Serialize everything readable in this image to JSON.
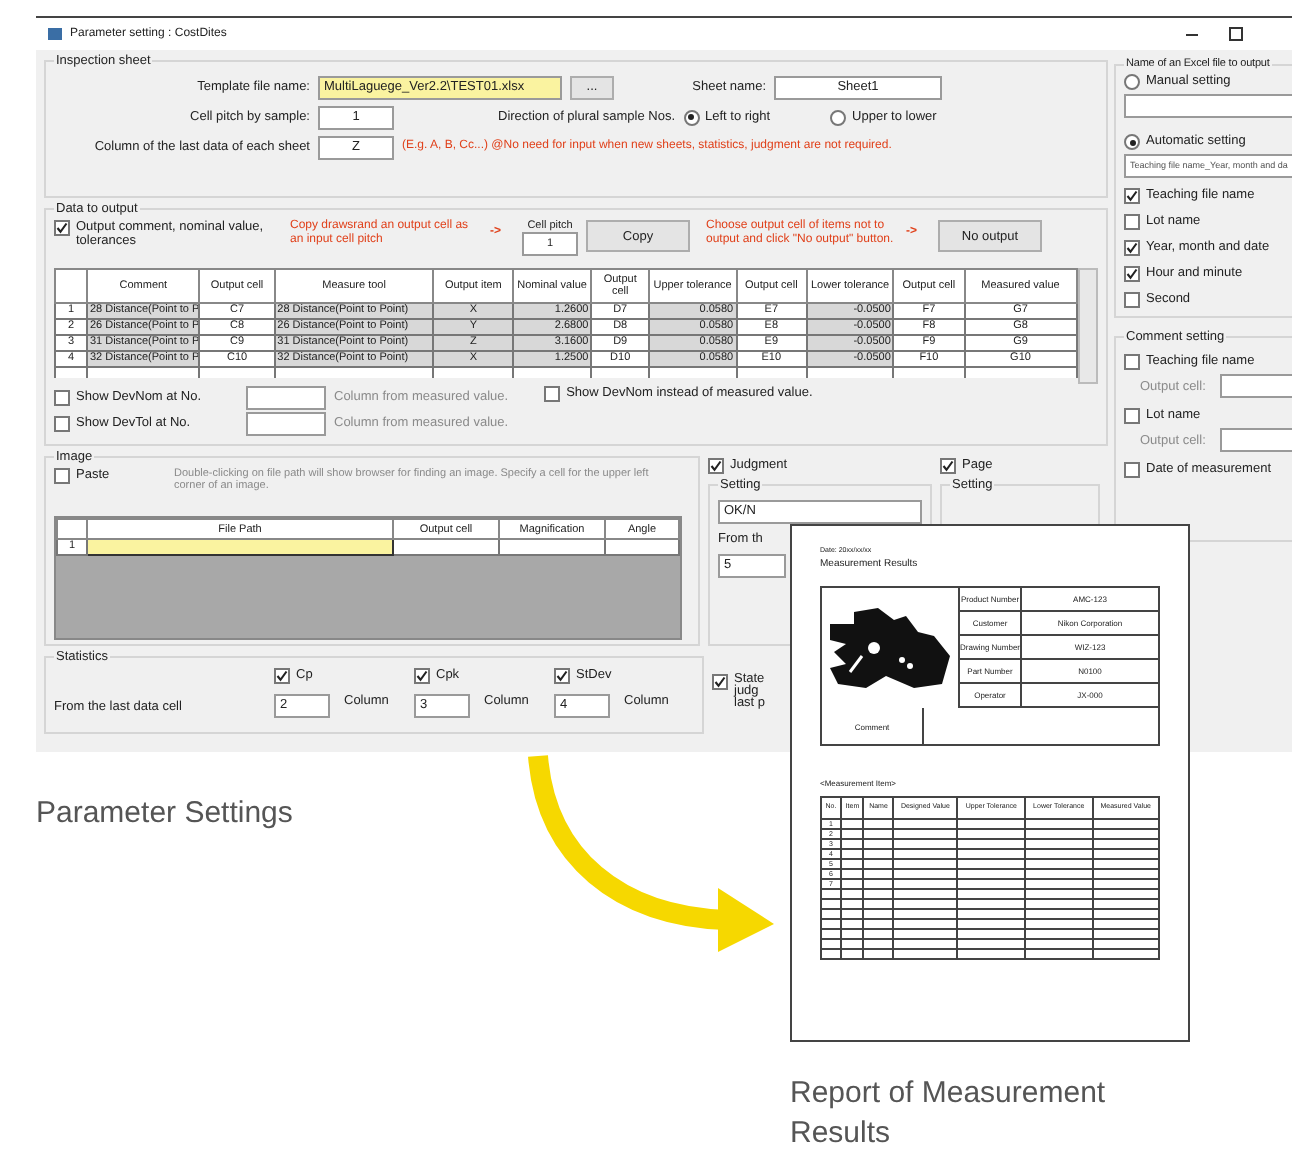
{
  "window": {
    "title": "Parameter setting : CostDites"
  },
  "inspection_sheet": {
    "title": "Inspection sheet",
    "template_label": "Template file name:",
    "template_value": "MultiLaguege_Ver2.2\\TEST01.xlsx",
    "browse_button": "...",
    "sheet_label": "Sheet name:",
    "sheet_value": "Sheet1",
    "pitch_label": "Cell pitch by sample:",
    "pitch_value": "1",
    "direction_label": "Direction of plural sample Nos.",
    "direction_options": [
      {
        "label": "Left to right",
        "selected": true
      },
      {
        "label": "Upper to lower",
        "selected": false
      }
    ],
    "last_column_label": "Column of the last data of each sheet",
    "last_column_value": "Z",
    "note": "(E.g. A, B, Cc...) @No need for input when new sheets, statistics, judgment are not required."
  },
  "data_to_output": {
    "title": "Data to output",
    "output_option": {
      "label": "Output comment, nominal value, tolerances",
      "checked": true
    },
    "copy_hint": "Copy drawsrand an output cell as an input cell pitch",
    "arrow_1": "->",
    "cell_pitch_label": "Cell pitch",
    "cell_pitch_value": "1",
    "copy_button": "Copy",
    "no_output_hint": "Choose output cell of items not to output and click \"No output\" button.",
    "arrow_2": "->",
    "no_output_button": "No output",
    "columns": [
      "Comment",
      "Output cell",
      "Measure tool",
      "Output item",
      "Nominal value",
      "Output cell",
      "Upper tolerance",
      "Output cell",
      "Lower tolerance",
      "Output cell",
      "Measured value"
    ],
    "rows": [
      {
        "no": "1",
        "cells": [
          "28 Distance(Point to P",
          "C7",
          "28 Distance(Point to Point)",
          "X",
          "1.2600",
          "D7",
          "0.0580",
          "E7",
          "-0.0500",
          "F7",
          "G7"
        ]
      },
      {
        "no": "2",
        "cells": [
          "26 Distance(Point to P",
          "C8",
          "26 Distance(Point to Point)",
          "Y",
          "2.6800",
          "D8",
          "0.0580",
          "E8",
          "-0.0500",
          "F8",
          "G8"
        ]
      },
      {
        "no": "3",
        "cells": [
          "31 Distance(Point to P",
          "C9",
          "31 Distance(Point to Point)",
          "Z",
          "3.1600",
          "D9",
          "0.0580",
          "E9",
          "-0.0500",
          "F9",
          "G9"
        ]
      },
      {
        "no": "4",
        "cells": [
          "32 Distance(Point to P",
          "C10",
          "32 Distance(Point to Point)",
          "X",
          "1.2500",
          "D10",
          "0.0580",
          "E10",
          "-0.0500",
          "F10",
          "G10"
        ]
      }
    ],
    "show_options": [
      {
        "label": "Show DevNom at No.",
        "checked": false,
        "hint": "Column from measured value."
      },
      {
        "label": "Show DevTol at No.",
        "checked": false,
        "hint": "Column from measured value."
      }
    ],
    "devnom_instead": {
      "label": "Show DevNom instead of measured value.",
      "checked": false
    }
  },
  "image": {
    "title": "Image",
    "paste": {
      "label": "Paste",
      "checked": false
    },
    "hint": "Double-clicking on file path will show browser for finding an image. Specify a cell for the upper left corner of an image.",
    "columns": [
      "File Path",
      "Output cell",
      "Magnification",
      "Angle"
    ],
    "rows": [
      {
        "no": "1"
      }
    ]
  },
  "judgment": {
    "label": "Judgment",
    "checked": true,
    "setting_title": "Setting",
    "value": "OK/N",
    "from_label": "From th",
    "from_value": "5"
  },
  "page": {
    "label": "Page",
    "checked": true,
    "setting_title": "Setting"
  },
  "statistics": {
    "title": "Statistics",
    "from_label": "From the last data cell",
    "items": [
      {
        "label": "Cp",
        "checked": true,
        "value": "2",
        "unit": "Column"
      },
      {
        "label": "Cpk",
        "checked": true,
        "value": "3",
        "unit": "Column"
      },
      {
        "label": "StDev",
        "checked": true,
        "value": "4",
        "unit": "Column"
      }
    ],
    "state_option": {
      "lines": [
        "State",
        "judg",
        "last p"
      ],
      "checked": true
    }
  },
  "excel_file": {
    "title": "Name of an Excel file to output",
    "manual": {
      "label": "Manual setting",
      "selected": false
    },
    "automatic": {
      "label": "Automatic setting",
      "selected": true
    },
    "automatic_value": "Teaching file name_Year, month and da",
    "parts": [
      {
        "label": "Teaching file name",
        "checked": true
      },
      {
        "label": "Lot name",
        "checked": false
      },
      {
        "label": "Year, month and date",
        "checked": true
      },
      {
        "label": "Hour and minute",
        "checked": true
      },
      {
        "label": "Second",
        "checked": false
      }
    ]
  },
  "comment_setting": {
    "title": "Comment setting",
    "items": [
      {
        "label": "Teaching file name",
        "checked": false,
        "cell_label": "Output cell:"
      },
      {
        "label": "Lot name",
        "checked": false,
        "cell_label": "Output cell:"
      }
    ],
    "date_option": {
      "label": "Date of measurement",
      "checked": false
    }
  },
  "report": {
    "date": "Date: 20xx/xx/xx",
    "title": "Measurement Results",
    "fields": [
      {
        "label": "Product Number",
        "value": "AMC-123"
      },
      {
        "label": "Customer",
        "value": "Nikon Corporation"
      },
      {
        "label": "Drawing Number",
        "value": "WIZ-123"
      },
      {
        "label": "Part Number",
        "value": "N0100"
      },
      {
        "label": "Operator",
        "value": "JX-000"
      }
    ],
    "comment_label": "Comment",
    "items_title": "<Measurement Item>",
    "columns": [
      "No.",
      "Item",
      "Name",
      "Designed Value",
      "Upper Tolerance",
      "Lower Tolerance",
      "Measured Value"
    ],
    "row_numbers": [
      "1",
      "2",
      "3",
      "4",
      "5",
      "6",
      "7"
    ]
  },
  "captions": [
    "Parameter Settings",
    "Report of Measurement Results"
  ]
}
